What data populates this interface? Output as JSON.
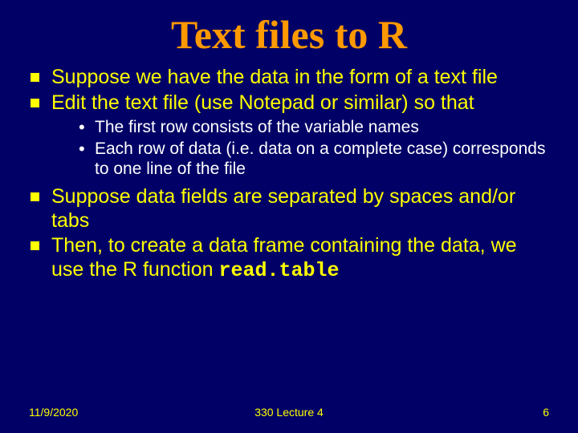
{
  "title": "Text files to R",
  "bullets": {
    "b1": "Suppose we have the data in the form of a text file",
    "b2": "Edit the text file (use Notepad or similar) so that",
    "s1": "The first row consists of the variable names",
    "s2": "Each row of data (i.e. data on a complete case) corresponds to one line of the file",
    "b3": "Suppose data fields are separated by spaces and/or tabs",
    "b4a": "Then, to create a data frame containing the data, we use the R function ",
    "b4b": "read.table"
  },
  "footer": {
    "date": "11/9/2020",
    "center": "330 Lecture 4",
    "page": "6"
  }
}
